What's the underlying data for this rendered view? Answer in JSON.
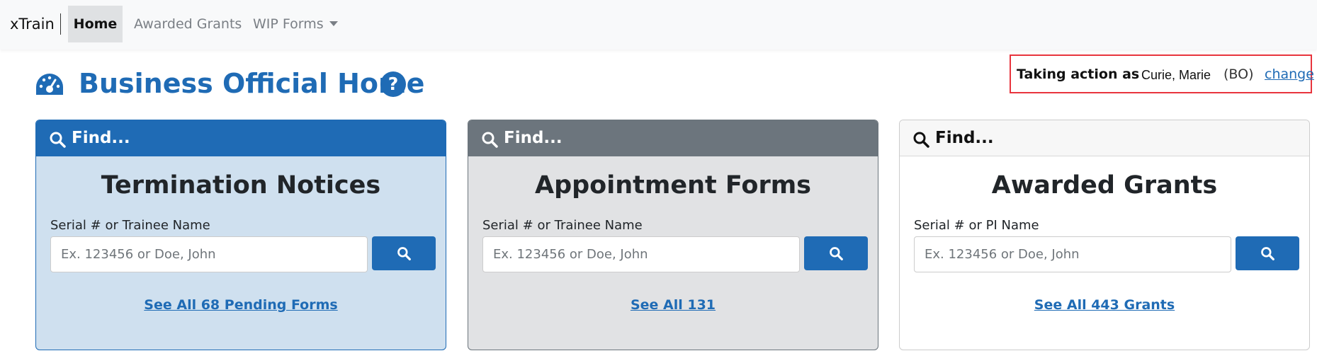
{
  "navbar": {
    "brand": "xTrain",
    "home": "Home",
    "awarded_grants": "Awarded Grants",
    "wip_forms": "WIP Forms"
  },
  "header": {
    "title": "Business Official Home",
    "help": "?"
  },
  "action": {
    "label": "Taking action as",
    "name": "Curie, Marie",
    "role": "(BO)",
    "change": "change"
  },
  "cards": [
    {
      "find": "Find...",
      "title": "Termination Notices",
      "field_label": "Serial # or Trainee Name",
      "placeholder": "Ex. 123456 or Doe, John",
      "link": "See All 68 Pending Forms"
    },
    {
      "find": "Find...",
      "title": "Appointment Forms",
      "field_label": "Serial # or Trainee Name",
      "placeholder": "Ex. 123456 or Doe, John",
      "link": "See All 131"
    },
    {
      "find": "Find...",
      "title": "Awarded Grants",
      "field_label": "Serial # or PI Name",
      "placeholder": "Ex. 123456 or Doe, John",
      "link": "See All 443 Grants"
    }
  ],
  "icons": {
    "header": "gauge-icon",
    "help": "question-circle-icon",
    "find": "search-icon"
  },
  "colors": {
    "primary": "#1f6bb5",
    "secondary": "#6c757d",
    "highlight_border": "#e8343d"
  }
}
